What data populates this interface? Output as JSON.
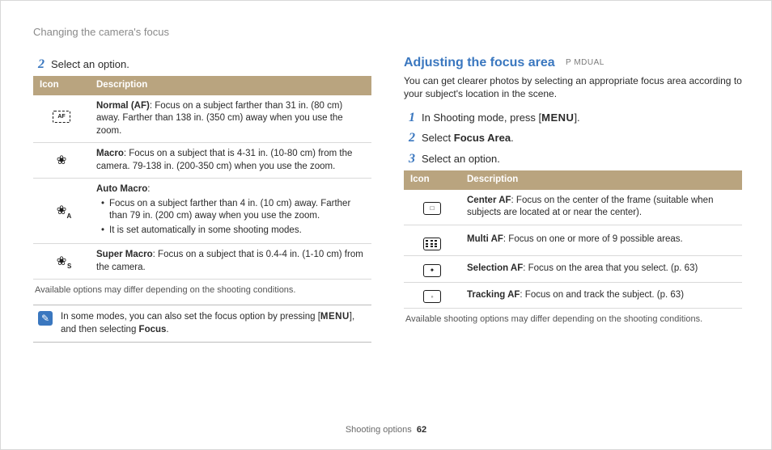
{
  "breadcrumb": "Changing the camera's focus",
  "left": {
    "step2_num": "2",
    "step2_text": "Select an option.",
    "table": {
      "head_icon": "Icon",
      "head_desc": "Description",
      "rows": [
        {
          "icon": "normal-af",
          "strong": "Normal (AF)",
          "rest": ": Focus on a subject farther than 31 in. (80 cm) away. Farther than 138 in. (350 cm) away when you use the zoom."
        },
        {
          "icon": "macro",
          "strong": "Macro",
          "rest": ": Focus on a subject that is 4-31 in. (10-80 cm) from the camera. 79-138 in. (200-350 cm) when you use the zoom."
        },
        {
          "icon": "auto-macro",
          "strong": "Auto Macro",
          "rest_strong_only": ":",
          "bullets": [
            "Focus on a subject farther than 4 in. (10 cm) away. Farther than 79 in. (200 cm) away when you use the zoom.",
            "It is set automatically in some shooting modes."
          ]
        },
        {
          "icon": "super-macro",
          "strong": "Super Macro",
          "rest": ": Focus on a subject that is 0.4-4 in. (1-10 cm) from the camera."
        }
      ]
    },
    "note": "Available options may differ depending on the shooting conditions.",
    "tip_pre": "In some modes, you can also set the focus option by pressing [",
    "tip_menu": "MENU",
    "tip_mid": "], and then selecting ",
    "tip_bold": "Focus",
    "tip_post": "."
  },
  "right": {
    "heading": "Adjusting the focus area",
    "modes": "P  MDUAL",
    "intro": "You can get clearer photos by selecting an appropriate focus area according to your subject's location in the scene.",
    "step1_num": "1",
    "step1_pre": "In Shooting mode, press [",
    "step1_menu": "MENU",
    "step1_post": "].",
    "step2_num": "2",
    "step2_pre": "Select ",
    "step2_bold": "Focus Area",
    "step2_post": ".",
    "step3_num": "3",
    "step3_text": "Select an option.",
    "table": {
      "head_icon": "Icon",
      "head_desc": "Description",
      "rows": [
        {
          "icon": "center-af",
          "strong": "Center AF",
          "rest": ": Focus on the center of the frame (suitable when subjects are located at or near the center)."
        },
        {
          "icon": "multi-af",
          "strong": "Multi AF",
          "rest": ": Focus on one or more of 9 possible areas."
        },
        {
          "icon": "selection-af",
          "strong": "Selection AF",
          "rest": ": Focus on the area that you select. (p. 63)"
        },
        {
          "icon": "tracking-af",
          "strong": "Tracking AF",
          "rest": ": Focus on and track the subject. (p. 63)"
        }
      ]
    },
    "note": "Available shooting options may differ depending on the shooting conditions."
  },
  "footer_label": "Shooting options",
  "footer_page": "62"
}
